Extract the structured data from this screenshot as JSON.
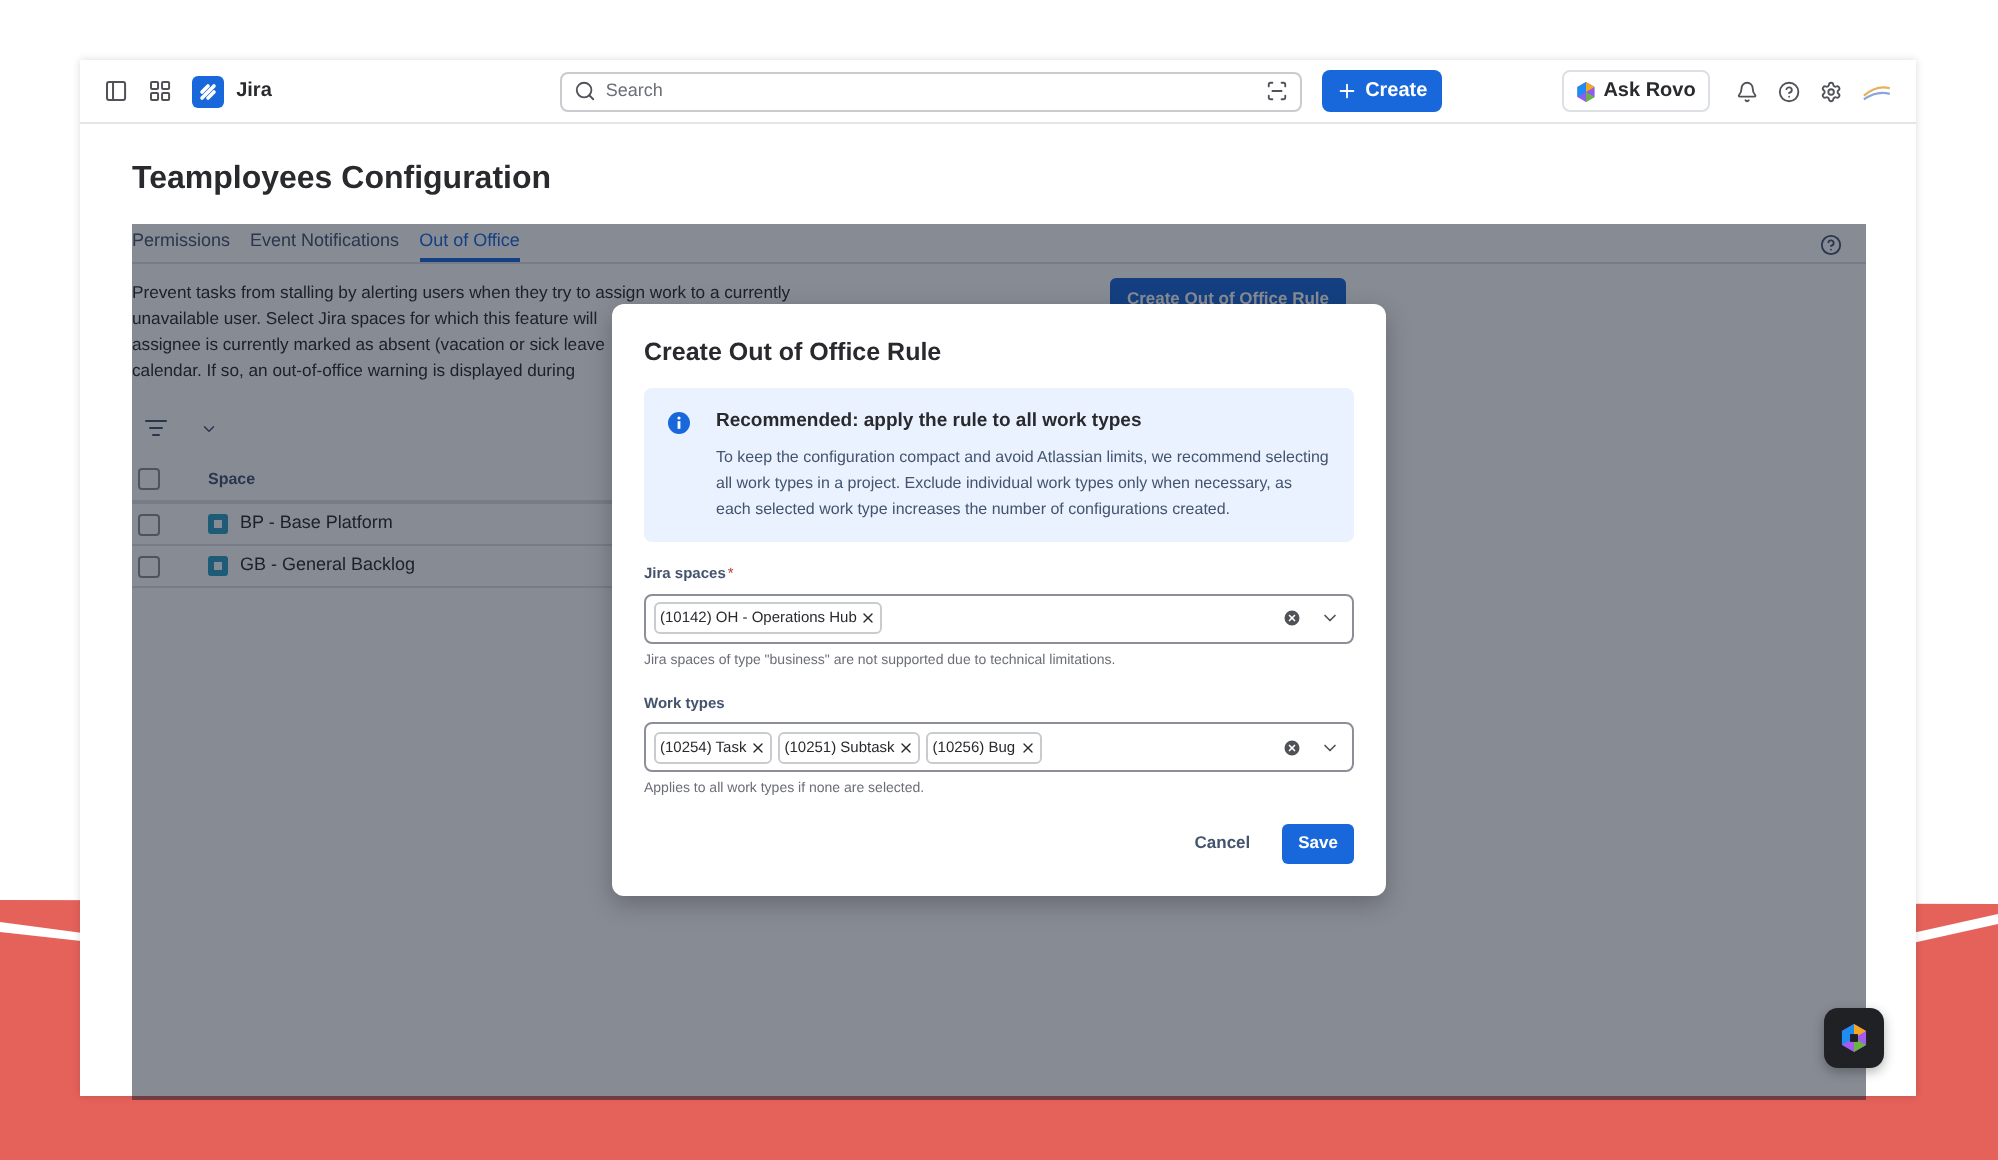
{
  "topbar": {
    "app_name": "Jira",
    "search": {
      "placeholder": "Search"
    },
    "create_button": "Create",
    "ask_button": "Ask Rovo"
  },
  "page_title": "Teamployees Configuration",
  "tabs": [
    {
      "label": "Permissions",
      "selected": false
    },
    {
      "label": "Event Notifications",
      "selected": false
    },
    {
      "label": "Out of Office",
      "selected": true
    }
  ],
  "description_lines": [
    "Prevent tasks from stalling by alerting users when they try to assign work to a currently",
    "unavailable user. Select Jira spaces for which this feature will",
    "assignee is currently marked as absent (vacation or sick leave",
    "calendar. If so, an out-of-office warning is displayed during"
  ],
  "create_rule_button": "Create Out of Office Rule",
  "table": {
    "header_checked": false,
    "columns": [
      "Space"
    ],
    "rows": [
      {
        "space": "BP - Base Platform",
        "checked": false
      },
      {
        "space": "GB - General Backlog",
        "checked": false
      }
    ]
  },
  "dialog": {
    "title": "Create Out of Office Rule",
    "notice": {
      "title": "Recommended: apply the rule to all work types",
      "text": "To keep the configuration compact and avoid Atlassian limits, we recommend selecting all work types in a project. Exclude individual work types only when necessary, as each selected work type increases the number of configurations created."
    },
    "fields": [
      {
        "label": "Jira spaces",
        "required_mark": "*",
        "tags": [
          "(10142) OH - Operations Hub"
        ],
        "hint": "Jira spaces of type \"business\" are not supported due to technical limitations."
      },
      {
        "label": "Work types",
        "tags": [
          "(10254) Task",
          "(10251) Subtask",
          "(10256) Bug"
        ],
        "hint": "Applies to all work types if none are selected."
      }
    ],
    "cancel_button": "Cancel",
    "save_button": "Save"
  }
}
